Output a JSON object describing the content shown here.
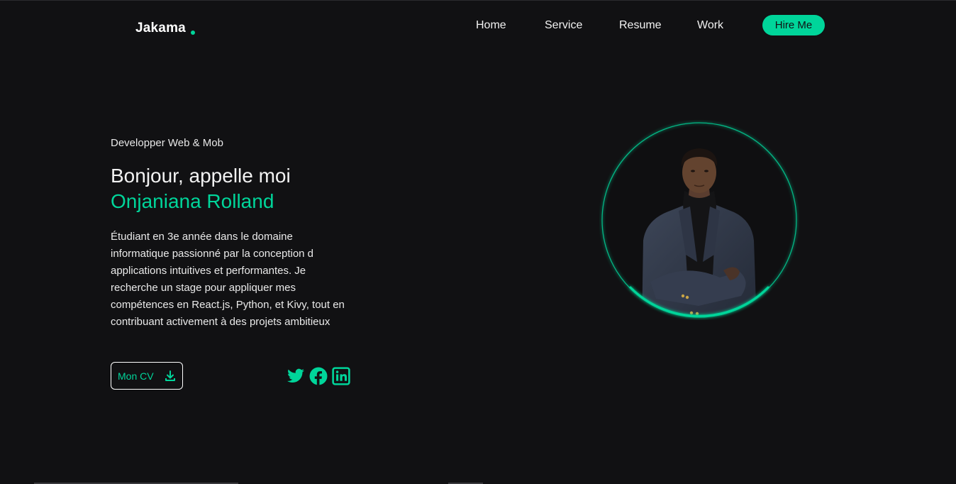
{
  "header": {
    "logo": "Jakama",
    "nav": [
      {
        "label": "Home"
      },
      {
        "label": "Service"
      },
      {
        "label": "Resume"
      },
      {
        "label": "Work"
      }
    ],
    "hire_label": "Hire Me"
  },
  "hero": {
    "subtitle": "Developper Web & Mob",
    "greeting": "Bonjour, appelle moi",
    "name": "Onjaniana Rolland",
    "description": "Étudiant en 3e année dans le domaine informatique passionné par la conception d applications intuitives et performantes. Je recherche un stage pour appliquer mes compétences en React.js, Python, et Kivy, tout en contribuant activement à des projets ambitieux",
    "cv_label": "Mon CV",
    "socials": [
      {
        "icon": "twitter-icon"
      },
      {
        "icon": "facebook-icon"
      },
      {
        "icon": "linkedin-icon"
      }
    ]
  },
  "colors": {
    "accent": "#00d59a",
    "background": "#111113"
  }
}
